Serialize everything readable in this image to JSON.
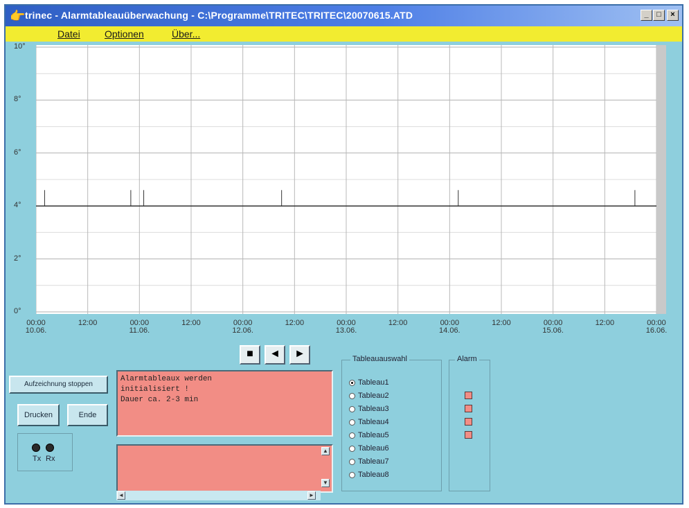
{
  "window": {
    "title": "trinec - Alarmtableauüberwachung - C:\\Programme\\TRITEC\\TRITEC\\20070615.ATD",
    "min_label": "_",
    "max_label": "□",
    "close_label": "×"
  },
  "menu": {
    "items": [
      {
        "label": "Datei"
      },
      {
        "label": "Optionen"
      },
      {
        "label": "Über..."
      }
    ]
  },
  "chart_data": {
    "type": "line",
    "title": "",
    "xlabel": "",
    "ylabel": "",
    "ylim": [
      0,
      10
    ],
    "y_ticks": [
      "10°",
      "8°",
      "6°",
      "4°",
      "2°",
      "0°"
    ],
    "x_ticks": [
      {
        "time": "00:00",
        "date": "10.06."
      },
      {
        "time": "12:00",
        "date": ""
      },
      {
        "time": "00:00",
        "date": "11.06."
      },
      {
        "time": "12:00",
        "date": ""
      },
      {
        "time": "00:00",
        "date": "12.06."
      },
      {
        "time": "12:00",
        "date": ""
      },
      {
        "time": "00:00",
        "date": "13.06."
      },
      {
        "time": "12:00",
        "date": ""
      },
      {
        "time": "00:00",
        "date": "14.06."
      },
      {
        "time": "12:00",
        "date": ""
      },
      {
        "time": "00:00",
        "date": "15.06."
      },
      {
        "time": "12:00",
        "date": ""
      },
      {
        "time": "00:00",
        "date": "16.06."
      }
    ],
    "grid": true,
    "baseline_value": 4,
    "spikes_x_hours": [
      2,
      22,
      25,
      57,
      98,
      139,
      145
    ],
    "spike_height": 0.6
  },
  "controls": {
    "stop_symbol": "■",
    "prev_symbol": "◄",
    "next_symbol": "►",
    "record_button": "Aufzeichnung stoppen",
    "print_button": "Drucken",
    "end_button": "Ende",
    "led_tx": "Tx",
    "led_rx": "Rx"
  },
  "log": {
    "lines": "Alarmtableaux werden\ninitialisiert !\nDauer ca. 2-3 min"
  },
  "tableau_group": {
    "title": "Tableauauswahl",
    "options": [
      {
        "label": "Tableau1",
        "selected": true
      },
      {
        "label": "Tableau2",
        "selected": false
      },
      {
        "label": "Tableau3",
        "selected": false
      },
      {
        "label": "Tableau4",
        "selected": false
      },
      {
        "label": "Tableau5",
        "selected": false
      },
      {
        "label": "Tableau6",
        "selected": false
      },
      {
        "label": "Tableau7",
        "selected": false
      },
      {
        "label": "Tableau8",
        "selected": false
      }
    ]
  },
  "alarm_group": {
    "title": "Alarm",
    "indicator_count": 4
  },
  "colors": {
    "menubar": "#f2ec30",
    "panel": "#8ecfdd",
    "textbox": "#f28d85"
  }
}
